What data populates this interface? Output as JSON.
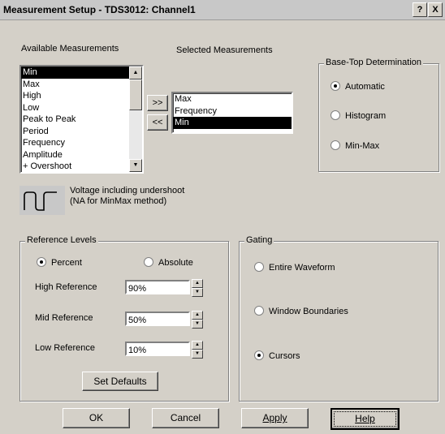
{
  "window": {
    "title": "Measurement Setup - TDS3012: Channel1",
    "help_glyph": "?",
    "close_glyph": "X"
  },
  "available": {
    "label": "Available Measurements",
    "items": [
      {
        "label": "Min",
        "selected": true
      },
      {
        "label": "Max",
        "selected": false
      },
      {
        "label": "High",
        "selected": false
      },
      {
        "label": "Low",
        "selected": false
      },
      {
        "label": "Peak to Peak",
        "selected": false
      },
      {
        "label": "Period",
        "selected": false
      },
      {
        "label": "Frequency",
        "selected": false
      },
      {
        "label": "Amplitude",
        "selected": false
      },
      {
        "label": "+ Overshoot",
        "selected": false
      }
    ]
  },
  "transfer": {
    "add_label": ">>",
    "remove_label": "<<"
  },
  "selected": {
    "label": "Selected Measurements",
    "items": [
      {
        "label": "Max",
        "selected": false
      },
      {
        "label": "Frequency",
        "selected": false
      },
      {
        "label": "Min",
        "selected": true
      }
    ]
  },
  "description": {
    "line1": "Voltage including undershoot",
    "line2": "(NA for MinMax method)"
  },
  "base_top": {
    "label": "Base-Top Determination",
    "options": [
      {
        "label": "Automatic",
        "checked": true
      },
      {
        "label": "Histogram",
        "checked": false
      },
      {
        "label": "Min-Max",
        "checked": false
      }
    ]
  },
  "reference": {
    "label": "Reference Levels",
    "mode_percent": "Percent",
    "mode_absolute": "Absolute",
    "percent_checked": true,
    "high_label": "High Reference",
    "high_value": "90%",
    "mid_label": "Mid Reference",
    "mid_value": "50%",
    "low_label": "Low Reference",
    "low_value": "10%",
    "defaults_button": "Set Defaults"
  },
  "gating": {
    "label": "Gating",
    "options": [
      {
        "label": "Entire Waveform",
        "checked": false
      },
      {
        "label": "Window Boundaries",
        "checked": false
      },
      {
        "label": "Cursors",
        "checked": true
      }
    ]
  },
  "buttons": {
    "ok": "OK",
    "cancel": "Cancel",
    "apply": "Apply",
    "help": "Help"
  }
}
